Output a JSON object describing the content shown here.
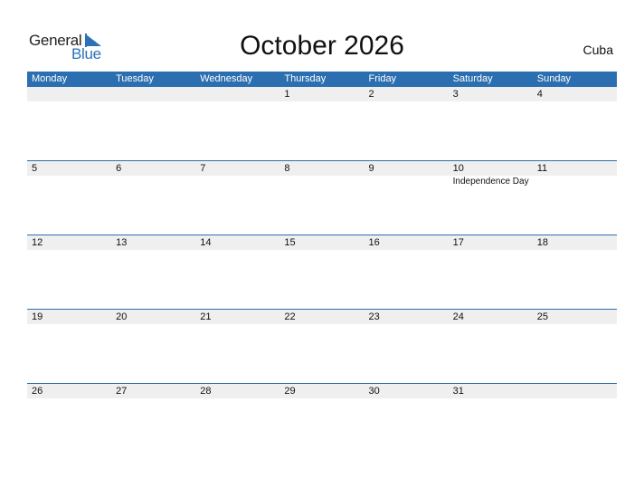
{
  "logo": {
    "line1": "General",
    "line2": "Blue"
  },
  "title": "October 2026",
  "country": "Cuba",
  "colors": {
    "header": "#2b6fb0",
    "band": "#efefef",
    "brand_blue": "#2a73b8"
  },
  "weekdays": [
    "Monday",
    "Tuesday",
    "Wednesday",
    "Thursday",
    "Friday",
    "Saturday",
    "Sunday"
  ],
  "weeks": [
    {
      "days": [
        "",
        "",
        "",
        "1",
        "2",
        "3",
        "4"
      ],
      "events": [
        "",
        "",
        "",
        "",
        "",
        "",
        ""
      ]
    },
    {
      "days": [
        "5",
        "6",
        "7",
        "8",
        "9",
        "10",
        "11"
      ],
      "events": [
        "",
        "",
        "",
        "",
        "",
        "Independence Day",
        ""
      ]
    },
    {
      "days": [
        "12",
        "13",
        "14",
        "15",
        "16",
        "17",
        "18"
      ],
      "events": [
        "",
        "",
        "",
        "",
        "",
        "",
        ""
      ]
    },
    {
      "days": [
        "19",
        "20",
        "21",
        "22",
        "23",
        "24",
        "25"
      ],
      "events": [
        "",
        "",
        "",
        "",
        "",
        "",
        ""
      ]
    },
    {
      "days": [
        "26",
        "27",
        "28",
        "29",
        "30",
        "31",
        ""
      ],
      "events": [
        "",
        "",
        "",
        "",
        "",
        "",
        ""
      ]
    }
  ]
}
